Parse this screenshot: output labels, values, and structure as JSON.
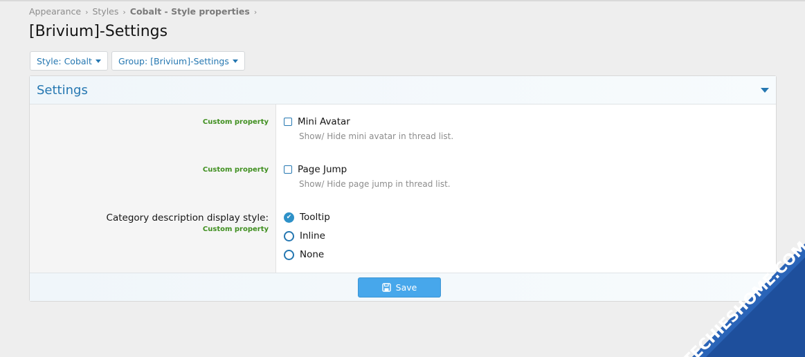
{
  "breadcrumb": {
    "items": [
      "Appearance",
      "Styles",
      "Cobalt - Style properties"
    ],
    "separator": "›"
  },
  "page": {
    "title": "[Brivium]-Settings"
  },
  "filters": {
    "style_button": "Style: Cobalt",
    "group_button": "Group: [Brivium]-Settings"
  },
  "panel": {
    "title": "Settings",
    "rows": [
      {
        "label": "",
        "hint": "Custom property",
        "option_label": "Mini Avatar",
        "description": "Show/ Hide mini avatar in thread list.",
        "checked": false
      },
      {
        "label": "",
        "hint": "Custom property",
        "option_label": "Page Jump",
        "description": "Show/ Hide page jump in thread list.",
        "checked": false
      },
      {
        "label": "Category description display style:",
        "hint": "Custom property",
        "options": [
          {
            "label": "Tooltip",
            "selected": true
          },
          {
            "label": "Inline",
            "selected": false
          },
          {
            "label": "None",
            "selected": false
          }
        ]
      }
    ],
    "save_label": "Save"
  },
  "watermark": {
    "text": "TECHIESHOME.COM"
  },
  "colors": {
    "accent": "#2577b1",
    "hint_green": "#3f8f1f",
    "save_button": "#47a7eb",
    "watermark_bg": "#1e4f9c",
    "watermark_orange": "#f5a31a"
  }
}
